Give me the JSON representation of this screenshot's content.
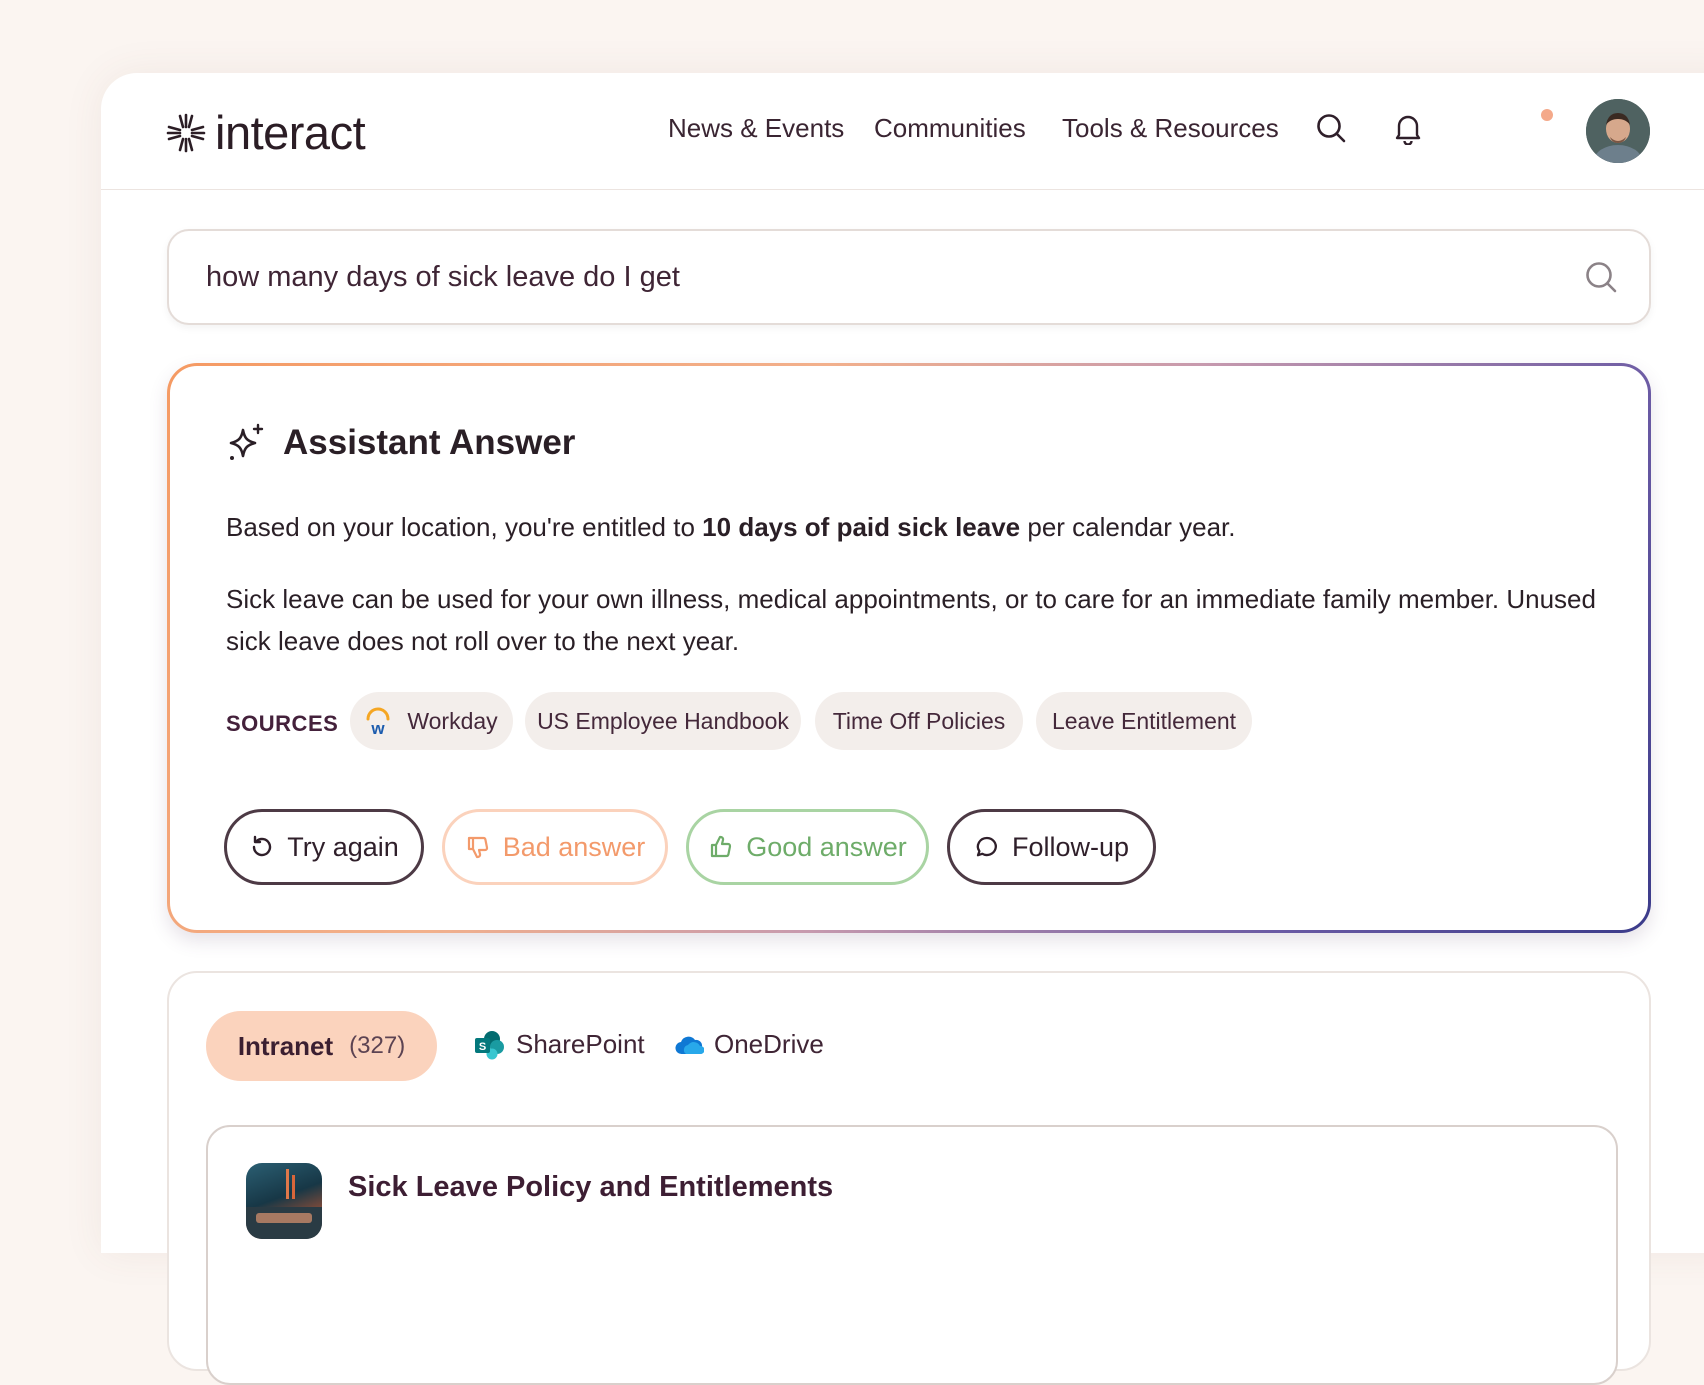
{
  "header": {
    "logo_text": "interact",
    "nav": [
      "News & Events",
      "Communities",
      "Tools & Resources"
    ],
    "has_notification": true
  },
  "search": {
    "query": "how many days of sick leave do I get"
  },
  "assistant": {
    "title": "Assistant Answer",
    "p1_prefix": "Based on your location, you're entitled to",
    "p1_bold": "10 days of paid sick leave",
    "p1_suffix": "per calendar year.",
    "p2": "Sick leave can be used for your own illness, medical appointments, or to care for an immediate family member. Unused sick leave does not roll over to the next year.",
    "sources_label": "SOURCES",
    "sources": [
      "Workday",
      "US Employee Handbook",
      "Time Off Policies",
      "Leave Entitlement"
    ],
    "buttons": {
      "try_again": "Try again",
      "bad": "Bad answer",
      "good": "Good answer",
      "follow_up": "Follow-up"
    }
  },
  "results": {
    "tabs": {
      "intranet": "Intranet",
      "intranet_count": "(327)",
      "sharepoint": "SharePoint",
      "onedrive": "OneDrive"
    },
    "items": [
      {
        "title": "Sick Leave Policy and Entitlements"
      }
    ]
  },
  "colors": {
    "accent_orange": "#f39a6b",
    "accent_green": "#6eac69",
    "accent_purple": "#3b3b8a",
    "tab_active_bg": "#fbd3bd"
  }
}
